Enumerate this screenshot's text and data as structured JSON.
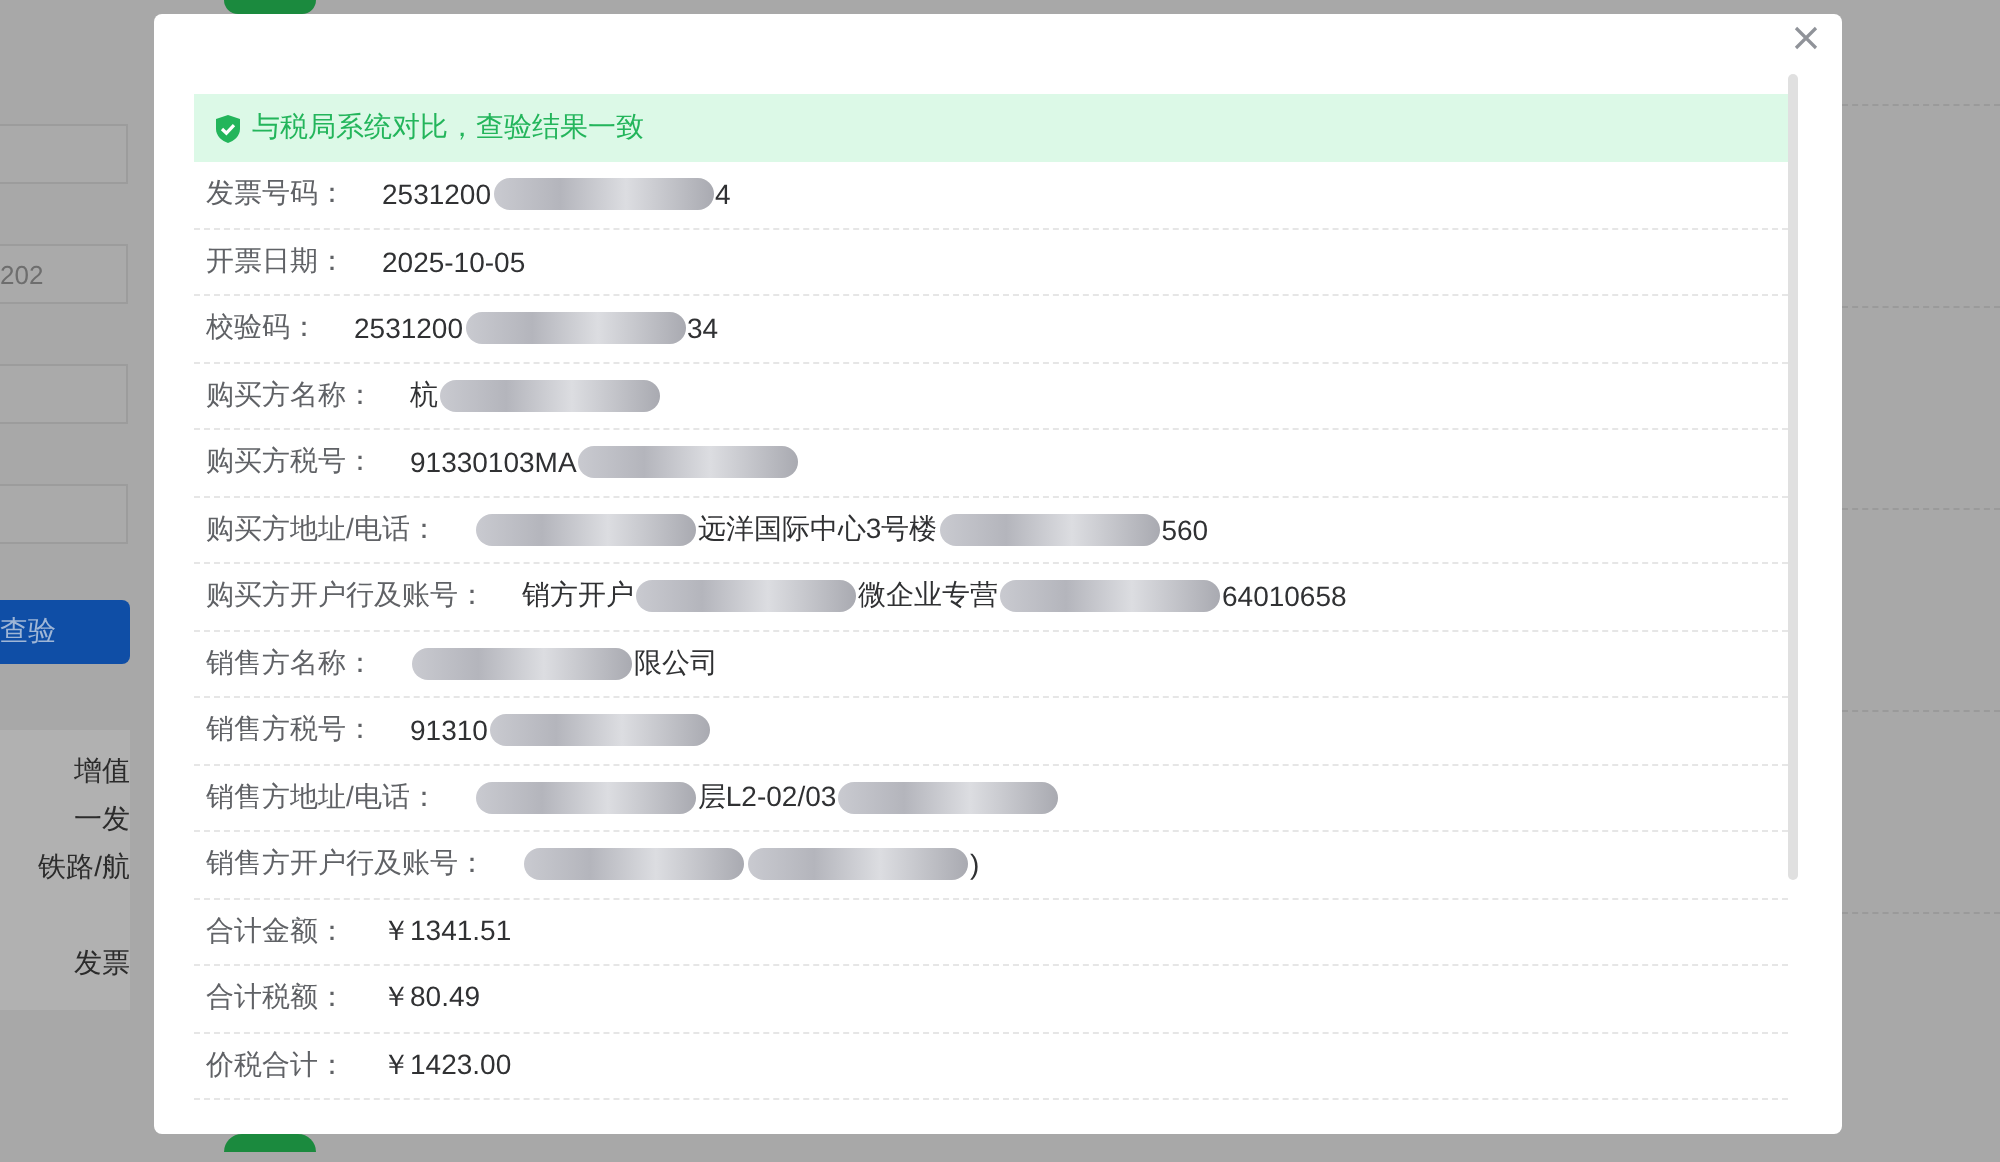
{
  "background": {
    "fields": [
      {
        "kind": "input"
      },
      {
        "kind": "input",
        "value": "202"
      },
      {
        "kind": "input"
      },
      {
        "kind": "input"
      }
    ],
    "button": "查验",
    "panel_lines": [
      "增值",
      "一发",
      "铁路/航",
      "发票"
    ]
  },
  "dialog": {
    "alert": "与税局系统对比，查验结果一致",
    "rows": [
      {
        "label": "发票号码：",
        "parts": [
          {
            "kind": "text",
            "text": "2531200"
          },
          {
            "kind": "redacted"
          },
          {
            "kind": "text",
            "text": "4"
          }
        ]
      },
      {
        "label": "开票日期：",
        "parts": [
          {
            "kind": "text",
            "text": "2025-10-05"
          }
        ]
      },
      {
        "label": "校验码：",
        "parts": [
          {
            "kind": "text",
            "text": "2531200"
          },
          {
            "kind": "redacted"
          },
          {
            "kind": "text",
            "text": "34"
          }
        ]
      },
      {
        "label": "购买方名称：",
        "parts": [
          {
            "kind": "text",
            "text": "杭"
          },
          {
            "kind": "redacted"
          }
        ]
      },
      {
        "label": "购买方税号：",
        "parts": [
          {
            "kind": "text",
            "text": "91330103MA"
          },
          {
            "kind": "redacted"
          }
        ]
      },
      {
        "label": "购买方地址/电话：",
        "parts": [
          {
            "kind": "redacted"
          },
          {
            "kind": "text",
            "text": "远洋国际中心3号楼"
          },
          {
            "kind": "redacted"
          },
          {
            "kind": "text",
            "text": "560"
          }
        ]
      },
      {
        "label": "购买方开户行及账号：",
        "parts": [
          {
            "kind": "text",
            "text": "销方开户"
          },
          {
            "kind": "redacted"
          },
          {
            "kind": "text",
            "text": "微企业专营"
          },
          {
            "kind": "redacted"
          },
          {
            "kind": "text",
            "text": "64010658"
          }
        ]
      },
      {
        "label": "销售方名称：",
        "parts": [
          {
            "kind": "redacted"
          },
          {
            "kind": "text",
            "text": "限公司"
          }
        ]
      },
      {
        "label": "销售方税号：",
        "parts": [
          {
            "kind": "text",
            "text": "91310"
          },
          {
            "kind": "redacted"
          }
        ]
      },
      {
        "label": "销售方地址/电话：",
        "parts": [
          {
            "kind": "redacted"
          },
          {
            "kind": "text",
            "text": "层L2-02/03"
          },
          {
            "kind": "redacted"
          }
        ]
      },
      {
        "label": "销售方开户行及账号：",
        "parts": [
          {
            "kind": "redacted"
          },
          {
            "kind": "redacted"
          },
          {
            "kind": "text",
            "text": ")"
          }
        ]
      },
      {
        "label": "合计金额：",
        "parts": [
          {
            "kind": "text",
            "text": "￥1341.51"
          }
        ]
      },
      {
        "label": "合计税额：",
        "parts": [
          {
            "kind": "text",
            "text": "￥80.49"
          }
        ]
      },
      {
        "label": "价税合计：",
        "parts": [
          {
            "kind": "text",
            "text": "￥1423.00"
          }
        ]
      }
    ]
  }
}
